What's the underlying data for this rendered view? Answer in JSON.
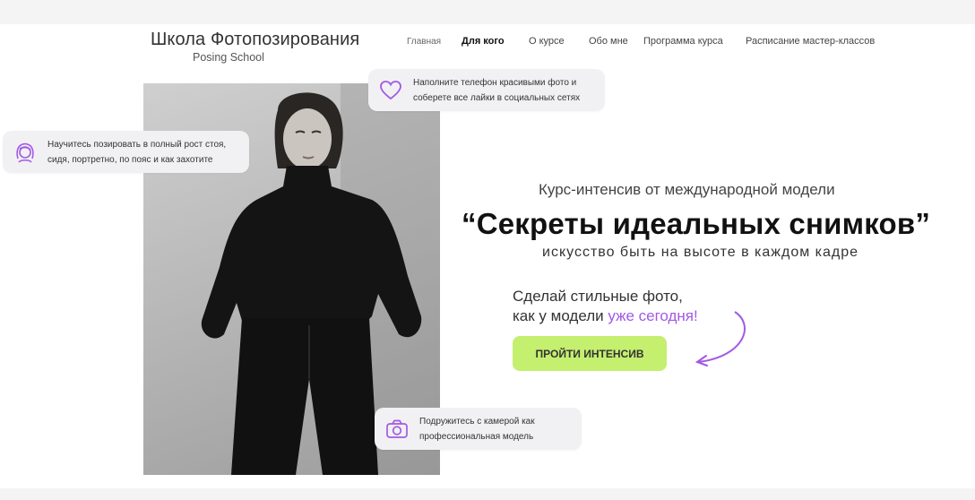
{
  "brand": {
    "title": "Школа Фотопозирования",
    "subtitle": "Posing School"
  },
  "nav": {
    "items": [
      {
        "label": "Главная"
      },
      {
        "label": "Для кого"
      },
      {
        "label": "О курсе"
      },
      {
        "label": "Обо мне"
      },
      {
        "label": "Программа курса"
      },
      {
        "label": "Расписание мастер-классов"
      }
    ],
    "active": "Для кого"
  },
  "features": [
    {
      "icon": "heart-icon",
      "line1": "Наполните телефон красивыми фото и",
      "line2": "соберете все лайки в социальных сетях"
    },
    {
      "icon": "girl-face-icon",
      "line1": "Научитесь позировать в полный рост стоя,",
      "line2": "сидя, портретно, по пояс и как захотите"
    },
    {
      "icon": "camera-icon",
      "line1": "Подружитесь с камерой как",
      "line2": "профессиональная модель"
    }
  ],
  "hero": {
    "subtitle": "Курс-интенсив от международной модели",
    "title": "“Секреты идеальных снимков”",
    "tagline": "искусство быть на высоте в каждом кадре"
  },
  "cta": {
    "line1": "Сделай стильные фото,",
    "line2_prefix": "как у модели",
    "line2_accent": "уже сегодня!",
    "button_label": "ПРОЙТИ ИНТЕНСИВ"
  },
  "colors": {
    "accent_purple": "#a259e6",
    "button_green": "#c4ef6f",
    "card_bg": "#f1f1f3"
  }
}
